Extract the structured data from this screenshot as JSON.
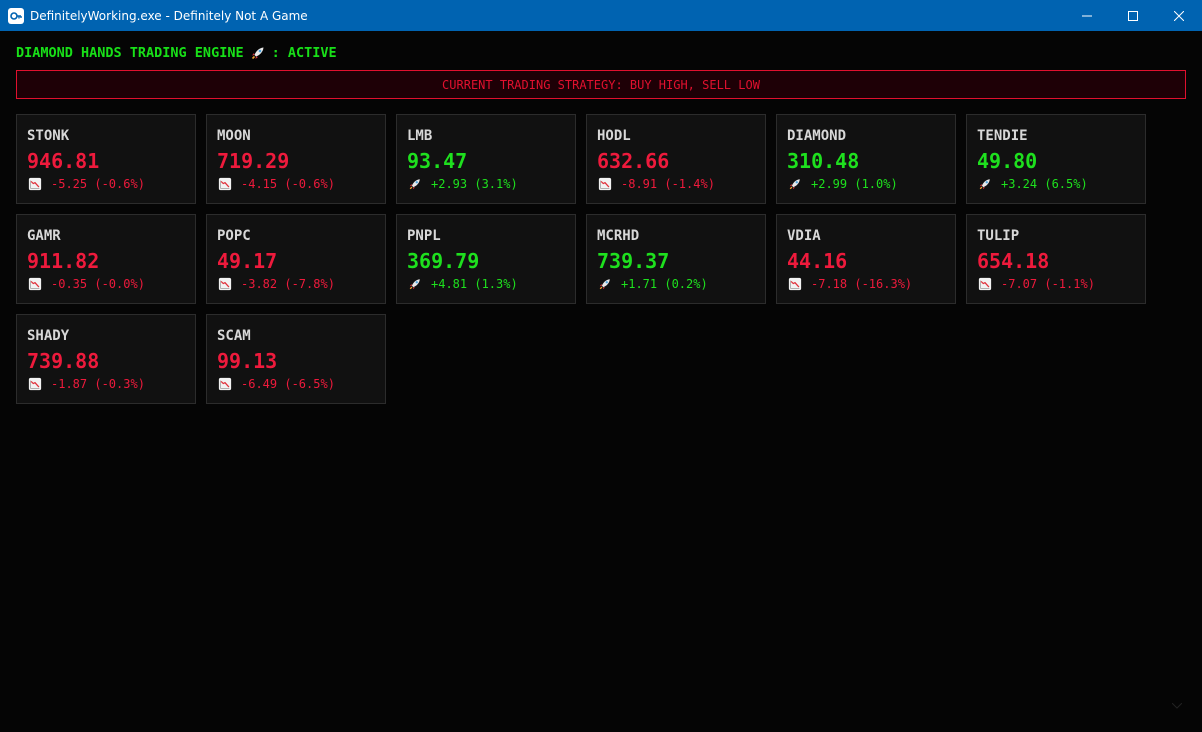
{
  "window": {
    "title": "DefinitelyWorking.exe - Definitely Not A Game",
    "icon": "app-icon"
  },
  "header": {
    "title": "DIAMOND HANDS TRADING ENGINE",
    "icon": "rocket-icon",
    "status": ": ACTIVE"
  },
  "strategy": {
    "text": "CURRENT TRADING STRATEGY: BUY HIGH, SELL LOW"
  },
  "colors": {
    "up": "#1ee01e",
    "down": "#ee1a3c",
    "titlebar": "#0063b1",
    "background": "#050505"
  },
  "stocks": [
    {
      "ticker": "STONK",
      "price": "946.81",
      "change": "-5.25 (-0.6%)",
      "dir": "down",
      "icon": "chart-down-icon"
    },
    {
      "ticker": "MOON",
      "price": "719.29",
      "change": "-4.15 (-0.6%)",
      "dir": "down",
      "icon": "chart-down-icon"
    },
    {
      "ticker": "LMB",
      "price": "93.47",
      "change": "+2.93 (3.1%)",
      "dir": "up",
      "icon": "rocket-icon"
    },
    {
      "ticker": "HODL",
      "price": "632.66",
      "change": "-8.91 (-1.4%)",
      "dir": "down",
      "icon": "chart-down-icon"
    },
    {
      "ticker": "DIAMOND",
      "price": "310.48",
      "change": "+2.99 (1.0%)",
      "dir": "up",
      "icon": "rocket-icon"
    },
    {
      "ticker": "TENDIE",
      "price": "49.80",
      "change": "+3.24 (6.5%)",
      "dir": "up",
      "icon": "rocket-icon"
    },
    {
      "ticker": "GAMR",
      "price": "911.82",
      "change": "-0.35 (-0.0%)",
      "dir": "down",
      "icon": "chart-down-icon"
    },
    {
      "ticker": "POPC",
      "price": "49.17",
      "change": "-3.82 (-7.8%)",
      "dir": "down",
      "icon": "chart-down-icon"
    },
    {
      "ticker": "PNPL",
      "price": "369.79",
      "change": "+4.81 (1.3%)",
      "dir": "up",
      "icon": "rocket-icon"
    },
    {
      "ticker": "MCRHD",
      "price": "739.37",
      "change": "+1.71 (0.2%)",
      "dir": "up",
      "icon": "rocket-icon"
    },
    {
      "ticker": "VDIA",
      "price": "44.16",
      "change": "-7.18 (-16.3%)",
      "dir": "down",
      "icon": "chart-down-icon"
    },
    {
      "ticker": "TULIP",
      "price": "654.18",
      "change": "-7.07 (-1.1%)",
      "dir": "down",
      "icon": "chart-down-icon"
    },
    {
      "ticker": "SHADY",
      "price": "739.88",
      "change": "-1.87 (-0.3%)",
      "dir": "down",
      "icon": "chart-down-icon"
    },
    {
      "ticker": "SCAM",
      "price": "99.13",
      "change": "-6.49 (-6.5%)",
      "dir": "down",
      "icon": "chart-down-icon"
    }
  ]
}
